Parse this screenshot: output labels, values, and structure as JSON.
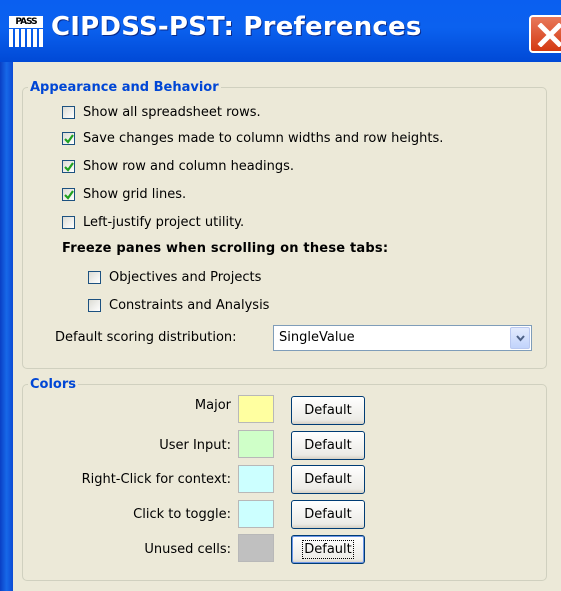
{
  "window": {
    "title": "CIPDSS-PST: Preferences",
    "icon_text": "PASS",
    "icon": "pass-app-icon",
    "close_icon": "close-icon"
  },
  "appearance": {
    "legend": "Appearance and Behavior",
    "options": [
      {
        "label": "Show all spreadsheet rows.",
        "checked": false
      },
      {
        "label": "Save changes made to column widths and row heights.",
        "checked": true
      },
      {
        "label": "Show row and column headings.",
        "checked": true
      },
      {
        "label": "Show grid lines.",
        "checked": true
      },
      {
        "label": "Left-justify project utility.",
        "checked": false
      }
    ],
    "freeze_heading": "Freeze panes when scrolling on these tabs:",
    "freeze_options": [
      {
        "label": "Objectives and Projects",
        "checked": false
      },
      {
        "label": "Constraints and Analysis",
        "checked": false
      }
    ],
    "scoring_label": "Default scoring distribution:",
    "scoring_value": "SingleValue"
  },
  "colors": {
    "legend": "Colors",
    "items": [
      {
        "label": "Major",
        "color": "#ffffa0",
        "button": "Default"
      },
      {
        "label": "User Input:",
        "color": "#cfffc8",
        "button": "Default"
      },
      {
        "label": "Right-Click for context:",
        "color": "#ccffff",
        "button": "Default"
      },
      {
        "label": "Click to toggle:",
        "color": "#ccffff",
        "button": "Default"
      },
      {
        "label": "Unused cells:",
        "color": "#c0c0c0",
        "button": "Default"
      }
    ]
  },
  "theme": {
    "titlebar": "#0a5ff0",
    "legend_color": "#0046d5",
    "background": "#ece9d8"
  }
}
